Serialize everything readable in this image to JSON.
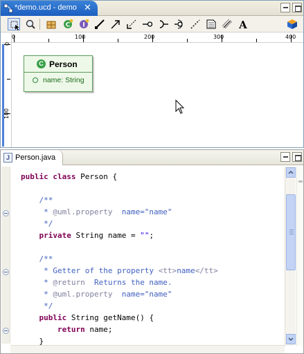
{
  "diagram_editor": {
    "tab_title": "*demo.ucd - demo",
    "close_glyph": "✕",
    "toolbar_icons": [
      "marquee-select-icon",
      "zoom-icon",
      "package-icon",
      "class-icon",
      "interface-icon",
      "association-icon",
      "dependency-icon",
      "generalization-icon",
      "realization-icon",
      "required-interface-icon",
      "provided-interface-icon",
      "anchor-icon",
      "note-icon",
      "note-link-icon",
      "text-icon",
      "palette-cube-icon"
    ],
    "ruler_h_labels": [
      "0",
      "100",
      "200",
      "300",
      "400"
    ],
    "ruler_v_labels": [
      "0",
      "100"
    ],
    "class_box": {
      "name": "Person",
      "icon_letter": "C",
      "attribute": "name: String"
    }
  },
  "java_editor": {
    "tab_title": "Person.java",
    "tab_icon_letter": "J",
    "code_lines": [
      [
        {
          "t": "public class ",
          "c": "kw"
        },
        {
          "t": "Person {",
          "c": "plain"
        }
      ],
      [],
      [
        {
          "t": "    /**",
          "c": "doc"
        }
      ],
      [
        {
          "t": "     * ",
          "c": "doc"
        },
        {
          "t": "@uml.property",
          "c": "tag"
        },
        {
          "t": "  name=\"name\"",
          "c": "doc"
        }
      ],
      [
        {
          "t": "     */",
          "c": "doc"
        }
      ],
      [
        {
          "t": "    private ",
          "c": "kw"
        },
        {
          "t": "String name = ",
          "c": "plain"
        },
        {
          "t": "\"\"",
          "c": "str"
        },
        {
          "t": ";",
          "c": "plain"
        }
      ],
      [],
      [
        {
          "t": "    /**",
          "c": "doc"
        }
      ],
      [
        {
          "t": "     * Getter of the property ",
          "c": "doc"
        },
        {
          "t": "<tt>",
          "c": "tag"
        },
        {
          "t": "name",
          "c": "doc"
        },
        {
          "t": "</tt>",
          "c": "tag"
        }
      ],
      [
        {
          "t": "     * ",
          "c": "doc"
        },
        {
          "t": "@return",
          "c": "tag"
        },
        {
          "t": "  Returns the name.",
          "c": "doc"
        }
      ],
      [
        {
          "t": "     * ",
          "c": "doc"
        },
        {
          "t": "@uml.property",
          "c": "tag"
        },
        {
          "t": "  name=\"name\"",
          "c": "doc"
        }
      ],
      [
        {
          "t": "     */",
          "c": "doc"
        }
      ],
      [
        {
          "t": "    public ",
          "c": "kw"
        },
        {
          "t": "String getName() {",
          "c": "plain"
        }
      ],
      [
        {
          "t": "        return ",
          "c": "kw"
        },
        {
          "t": "name;",
          "c": "plain"
        }
      ],
      [
        {
          "t": "    }",
          "c": "plain"
        }
      ]
    ],
    "fold_lines": [
      2,
      7,
      12
    ]
  },
  "colors": {
    "active_tab": "#1c5ec0",
    "keyword": "#7f0055",
    "javadoc": "#3f5fbf",
    "javadoc_tag": "#7f7f9f",
    "string": "#2a00ff",
    "class_fill": "#eef8e8",
    "class_border": "#5a9a5a"
  }
}
